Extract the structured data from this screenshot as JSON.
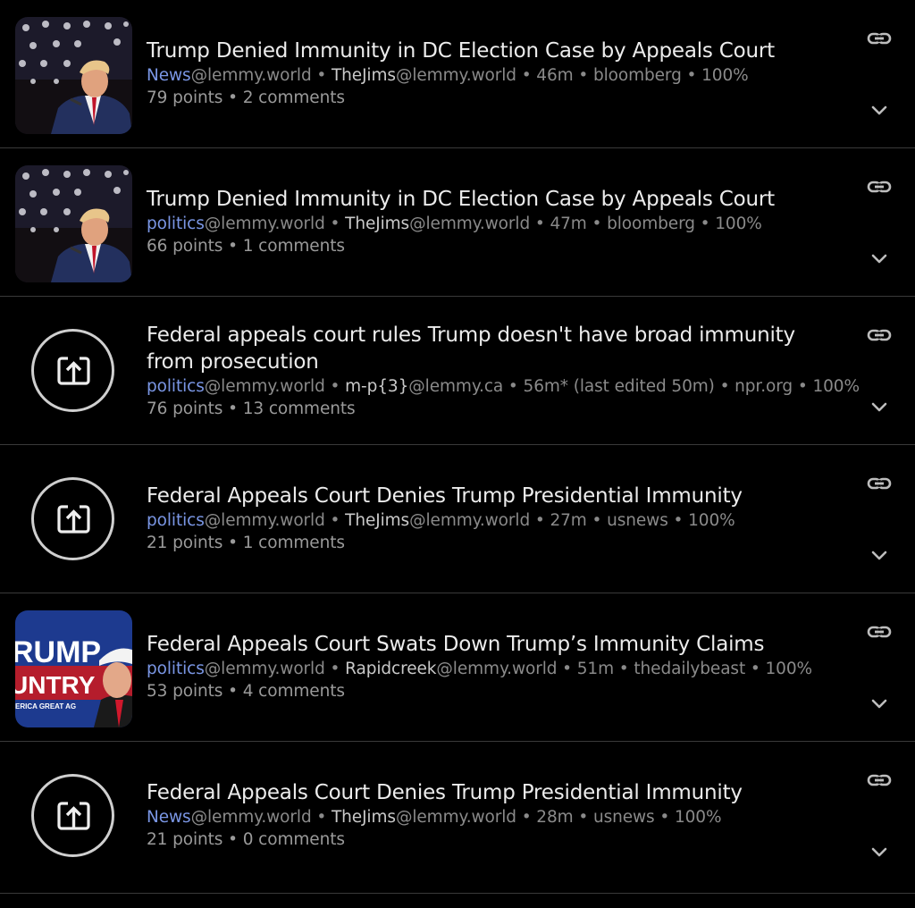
{
  "posts": [
    {
      "thumb": "photo-trump-flag",
      "title": "Trump Denied Immunity in DC Election Case by Appeals Court",
      "community": "News",
      "community_instance": "@lemmy.world",
      "sep1": " • ",
      "creator": "TheJims",
      "creator_instance": "@lemmy.world",
      "details": " • 46m • bloomberg • 100%",
      "stats": "79 points • 2 comments"
    },
    {
      "thumb": "photo-trump-flag",
      "title": "Trump Denied Immunity in DC Election Case by Appeals Court",
      "community": "politics",
      "community_instance": "@lemmy.world",
      "sep1": " • ",
      "creator": "TheJims",
      "creator_instance": "@lemmy.world",
      "details": " • 47m • bloomberg • 100%",
      "stats": "66 points • 1 comments"
    },
    {
      "thumb": "open-link-icon",
      "title": "Federal appeals court rules Trump doesn't have broad immunity from prosecution",
      "community": "politics",
      "community_instance": "@lemmy.world",
      "sep1": " • ",
      "creator": "m-p{3}",
      "creator_instance": "@lemmy.ca",
      "details": " • 56m* (last edited 50m) • npr.org • 100%",
      "stats": "76 points • 13 comments"
    },
    {
      "thumb": "open-link-icon",
      "title": "Federal Appeals Court Denies Trump Presidential Immunity",
      "community": "politics",
      "community_instance": "@lemmy.world",
      "sep1": " • ",
      "creator": "TheJims",
      "creator_instance": "@lemmy.world",
      "details": " • 27m • usnews • 100%",
      "stats": "21 points • 1 comments"
    },
    {
      "thumb": "photo-trump-country-sign",
      "thumb_text": [
        "RUMP",
        "UNTRY",
        "ERICA GREAT AG"
      ],
      "title": "Federal Appeals Court Swats Down Trump’s Immunity Claims",
      "community": "politics",
      "community_instance": "@lemmy.world",
      "sep1": " • ",
      "creator": "Rapidcreek",
      "creator_instance": "@lemmy.world",
      "details": " • 51m • thedailybeast • 100%",
      "stats": "53 points • 4 comments"
    },
    {
      "thumb": "open-link-icon",
      "title": "Federal Appeals Court Denies Trump Presidential Immunity",
      "community": "News",
      "community_instance": "@lemmy.world",
      "sep1": " • ",
      "creator": "TheJims",
      "creator_instance": "@lemmy.world",
      "details": " • 28m • usnews • 100%",
      "stats": "21 points • 0 comments"
    }
  ],
  "colors": {
    "background": "#000000",
    "community": "#7a96e4",
    "divider": "#3a3a3a"
  },
  "icons": {
    "link": "link-icon",
    "expand": "chevron-down-icon",
    "open_link": "open-link-icon"
  }
}
